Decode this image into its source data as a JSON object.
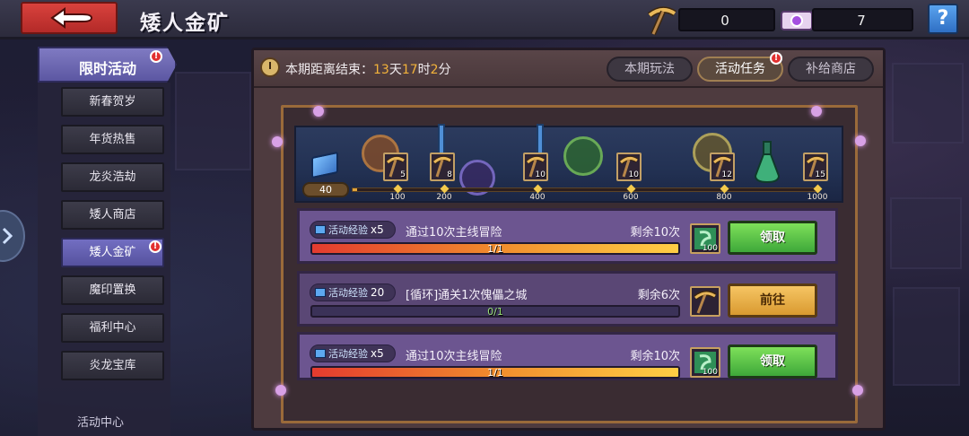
{
  "header": {
    "title": "矮人金矿",
    "pickaxe_count": "0",
    "gem_ticket_count": "7",
    "help_label": "?",
    "icons": {
      "back": "back-arrow-icon",
      "pickaxe": "pickaxe-icon",
      "ticket": "gem-ticket-icon",
      "help": "help-icon"
    }
  },
  "sidebar": {
    "header": "限时活动",
    "header_badge": "!",
    "items": [
      {
        "label": "新春贺岁",
        "active": false
      },
      {
        "label": "年货热售",
        "active": false
      },
      {
        "label": "龙炎浩劫",
        "active": false
      },
      {
        "label": "矮人商店",
        "active": false
      },
      {
        "label": "矮人金矿",
        "active": true,
        "badge": "!"
      },
      {
        "label": "魔印置换",
        "active": false
      },
      {
        "label": "福利中心",
        "active": false
      },
      {
        "label": "炎龙宝库",
        "active": false
      }
    ],
    "cut_off_label": "活动中心"
  },
  "panel": {
    "countdown_prefix": "本期距离结束：",
    "days": "13",
    "days_unit": "天",
    "hours": "17",
    "hours_unit": "时",
    "minutes": "2",
    "minutes_unit": "分",
    "tabs": [
      {
        "label": "本期玩法",
        "active": false
      },
      {
        "label": "活动任务",
        "active": true,
        "badge": "!"
      },
      {
        "label": "补给商店",
        "active": false
      }
    ]
  },
  "progress": {
    "current_exp": "40",
    "milestones": [
      {
        "value": "100",
        "reward_count": "5"
      },
      {
        "value": "200",
        "reward_count": "8"
      },
      {
        "value": "400",
        "reward_count": "10"
      },
      {
        "value": "600",
        "reward_count": "10"
      },
      {
        "value": "800",
        "reward_count": "12"
      },
      {
        "value": "1000",
        "reward_count": "15"
      }
    ],
    "reward_icon": "pickaxe-icon"
  },
  "tasks": [
    {
      "xp_label": "活动经验",
      "xp_amount": "x5",
      "desc": "通过10次主线冒险",
      "remaining": "剩余10次",
      "progress_text": "1/1",
      "progress_fraction": 1,
      "reward_icon": "green-sigil-icon",
      "reward_count": "100",
      "button": "领取",
      "button_type": "claim"
    },
    {
      "xp_label": "活动经验",
      "xp_amount": "20",
      "desc": "[循环]通关1次傀儡之城",
      "remaining": "剩余6次",
      "progress_text": "0/1",
      "progress_fraction": 0,
      "reward_icon": "pickaxe-icon",
      "reward_count": "",
      "button": "前往",
      "button_type": "goto"
    },
    {
      "xp_label": "活动经验",
      "xp_amount": "x5",
      "desc": "通过10次主线冒险",
      "remaining": "剩余10次",
      "progress_text": "1/1",
      "progress_fraction": 1,
      "reward_icon": "green-sigil-icon",
      "reward_count": "100",
      "button": "领取",
      "button_type": "claim"
    }
  ],
  "colors": {
    "accent_gold": "#f2b23a",
    "claim_green": "#4cc43f",
    "goto_orange": "#e6ad42",
    "sidebar_active": "#6a66b8"
  }
}
